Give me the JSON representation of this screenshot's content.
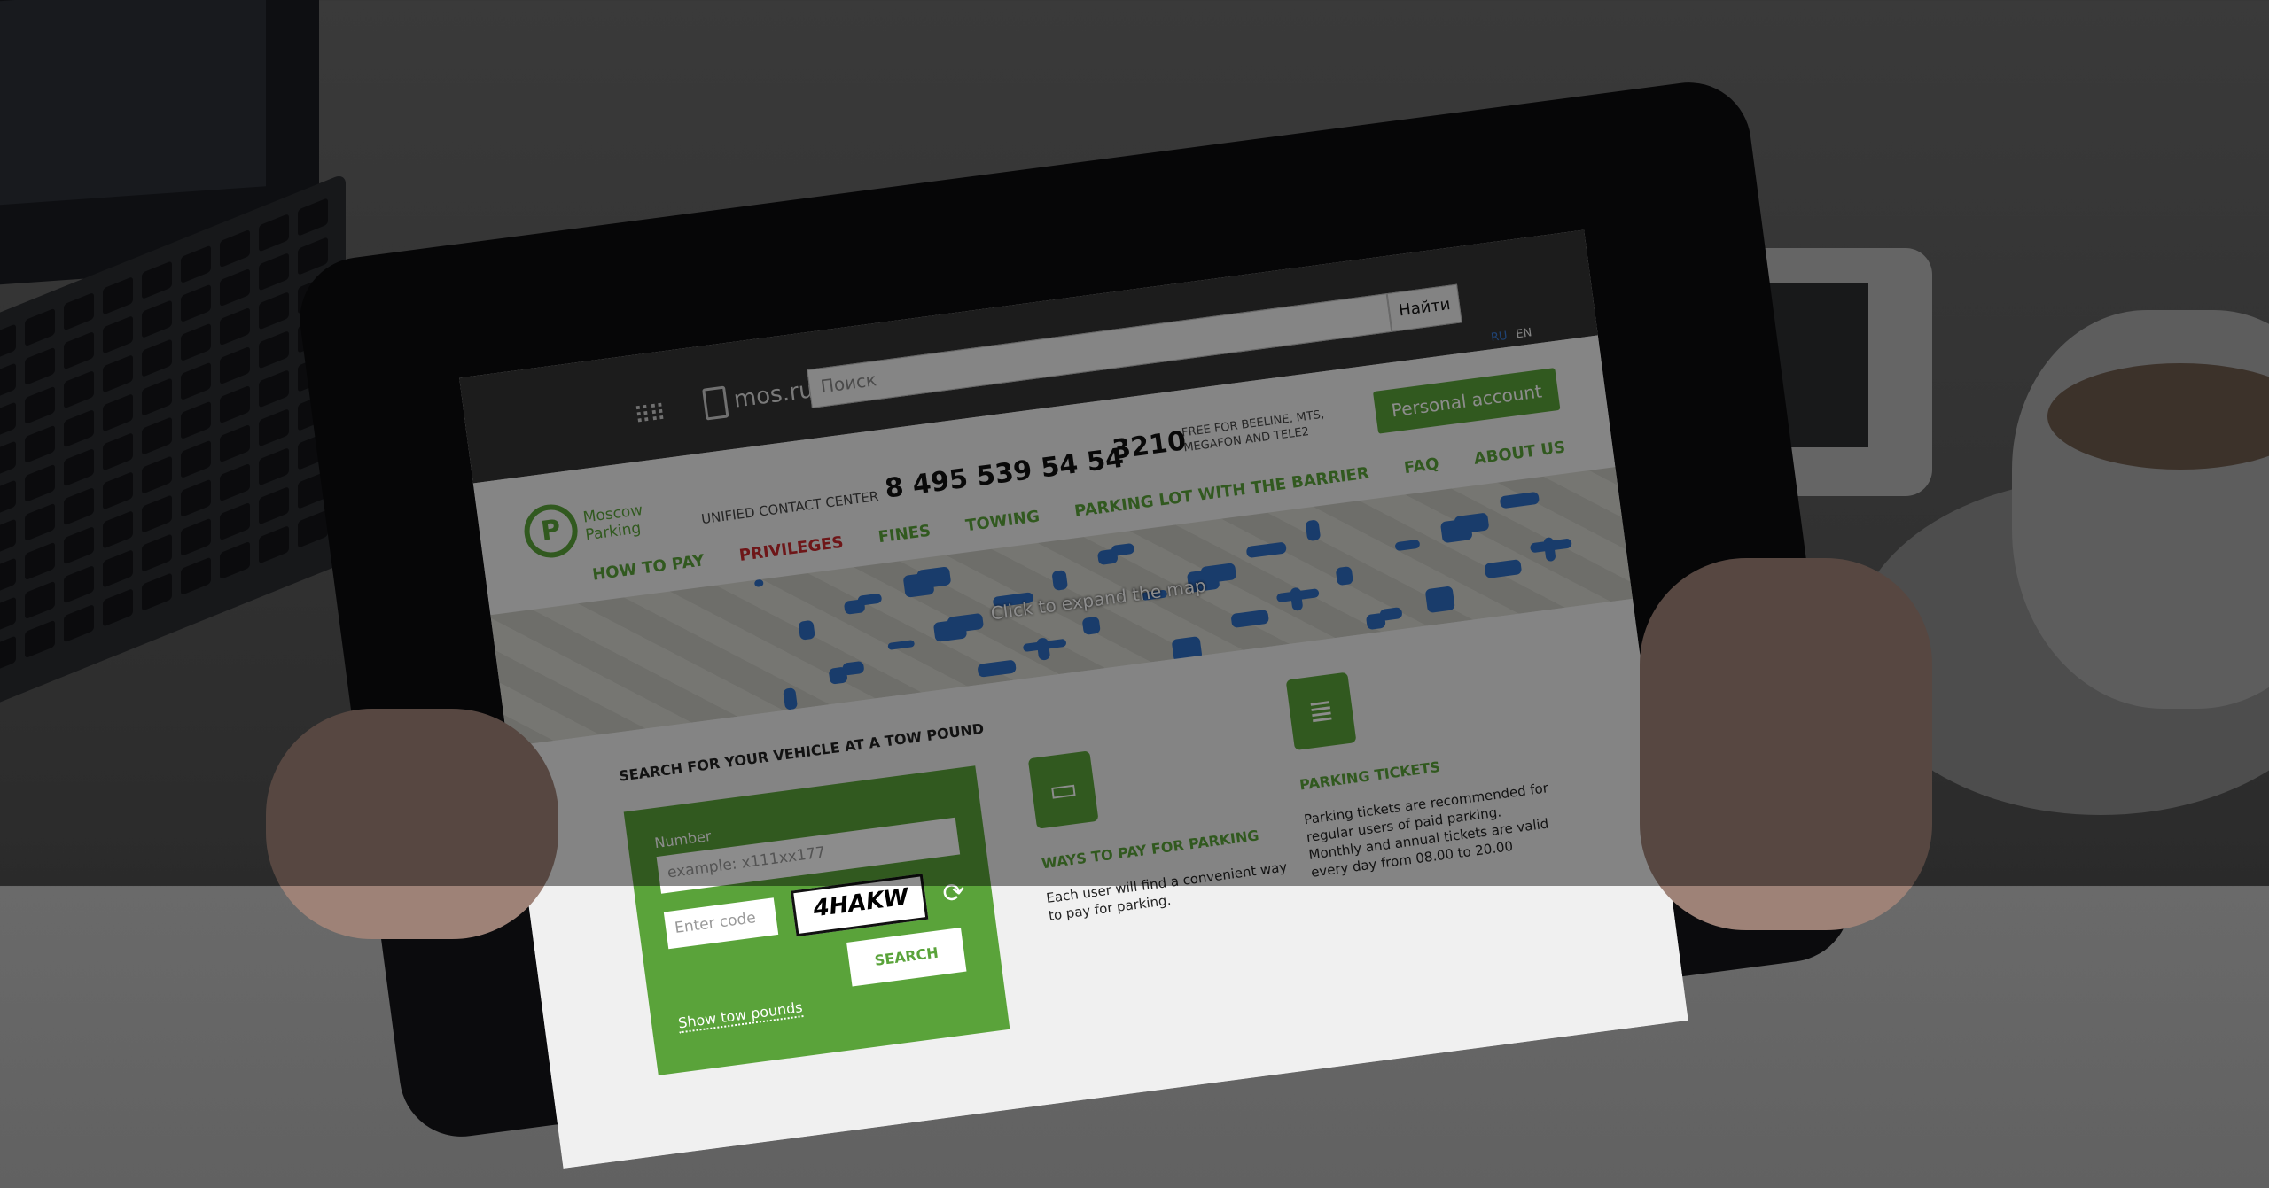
{
  "topbar": {
    "brand": "mos.ru",
    "search_placeholder": "Поиск",
    "search_button": "Найти",
    "lang_ru": "RU",
    "lang_en": "EN"
  },
  "header": {
    "logo_line1": "Moscow",
    "logo_line2": "Parking",
    "contact_label": "UNIFIED CONTACT CENTER",
    "phone": "8 495 539 54 54",
    "short_number": "3210",
    "short_note": "FREE FOR BEELINE, MTS, MEGAFON AND TELE2",
    "personal_account": "Personal account"
  },
  "nav": [
    "HOW TO PAY",
    "PRIVILEGES",
    "FINES",
    "TOWING",
    "PARKING LOT WITH THE BARRIER",
    "FAQ",
    "ABOUT US"
  ],
  "map": {
    "caption": "Click to expand the map"
  },
  "tow": {
    "title": "SEARCH FOR YOUR VEHICLE AT A TOW POUND",
    "number_label": "Number",
    "number_placeholder": "example: x111xx177",
    "code_placeholder": "Enter code",
    "captcha": "4HAKW",
    "search_button": "SEARCH",
    "show_link": "Show tow pounds"
  },
  "cards": [
    {
      "title": "WAYS TO PAY FOR PARKING",
      "text": "Each user will find a convenient way to pay for parking."
    },
    {
      "title": "PARKING TICKETS",
      "text": "Parking tickets are recommended for regular users of paid parking. Monthly and annual tickets are valid every day from 08.00 to 20.00"
    }
  ]
}
